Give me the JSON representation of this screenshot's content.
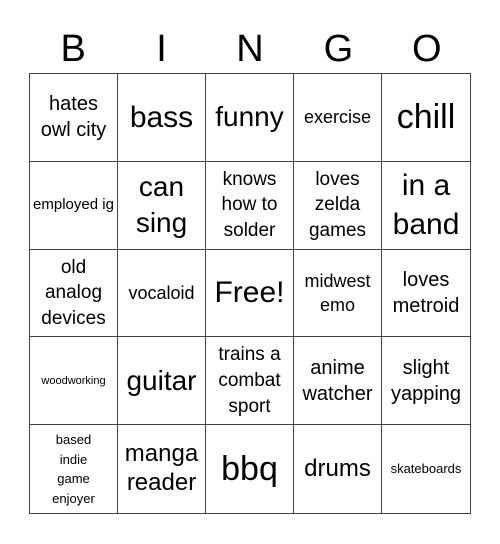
{
  "header": {
    "letters": [
      "B",
      "I",
      "N",
      "G",
      "O"
    ]
  },
  "cells": [
    {
      "text": "hates owl city"
    },
    {
      "text": "bass"
    },
    {
      "text": "funny"
    },
    {
      "text": "exercise"
    },
    {
      "text": "chill"
    },
    {
      "text": "employed ig"
    },
    {
      "text": "can sing"
    },
    {
      "text": "knows how to solder"
    },
    {
      "text": "loves zelda games"
    },
    {
      "text": "in a band"
    },
    {
      "text": "old analog devices"
    },
    {
      "text": "vocaloid"
    },
    {
      "text": "Free!"
    },
    {
      "text": "midwest emo"
    },
    {
      "text": "loves metroid"
    },
    {
      "text": "woodworking"
    },
    {
      "text": "guitar"
    },
    {
      "text": "trains a combat sport"
    },
    {
      "text": "anime watcher"
    },
    {
      "text": "slight yapping"
    },
    {
      "text": "based indie game enjoyer"
    },
    {
      "text": "manga reader"
    },
    {
      "text": "bbq"
    },
    {
      "text": "drums"
    },
    {
      "text": "skateboards"
    }
  ],
  "colors": {
    "grid_line": "#444444",
    "text": "#000000",
    "background": "#ffffff"
  }
}
